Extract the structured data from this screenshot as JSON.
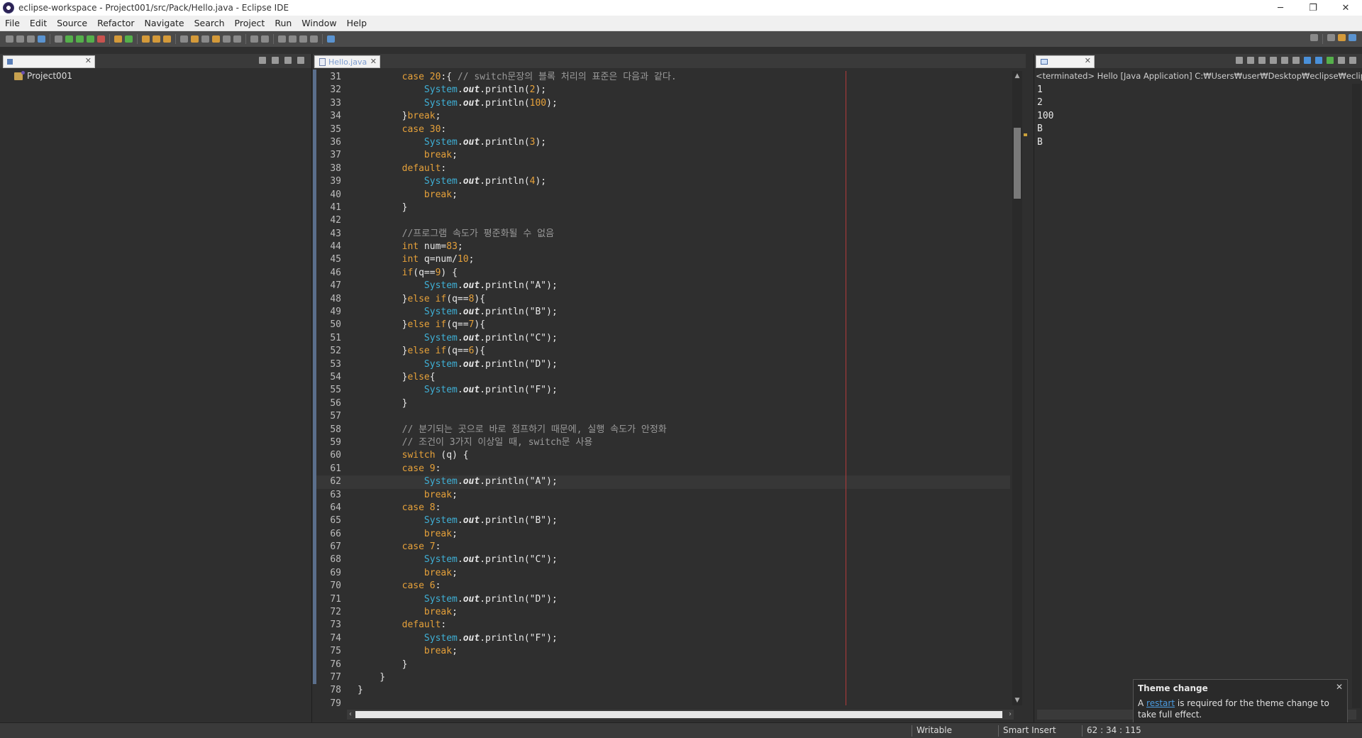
{
  "window": {
    "title": "eclipse-workspace - Project001/src/Pack/Hello.java - Eclipse IDE",
    "minimize": "─",
    "restore": "❐",
    "close": "✕"
  },
  "menubar": [
    "File",
    "Edit",
    "Source",
    "Refactor",
    "Navigate",
    "Search",
    "Project",
    "Run",
    "Window",
    "Help"
  ],
  "explorer": {
    "project": "Project001",
    "close_glyph": "✕"
  },
  "editor": {
    "tab_label": "Hello.java",
    "close_glyph": "✕",
    "current_line": 62
  },
  "code": [
    {
      "n": "31",
      "tokens": [
        [
          "pl",
          "        "
        ],
        [
          "kw",
          "case"
        ],
        [
          "pl",
          " "
        ],
        [
          "num",
          "20"
        ],
        [
          "pl",
          ":{ "
        ],
        [
          "cmt",
          "// switch문장의 블록 처리의 표준은 다음과 같다."
        ]
      ]
    },
    {
      "n": "32",
      "tokens": [
        [
          "pl",
          "            "
        ],
        [
          "cls",
          "System"
        ],
        [
          "pl",
          "."
        ],
        [
          "fld",
          "out"
        ],
        [
          "pl",
          ".println("
        ],
        [
          "num",
          "2"
        ],
        [
          "pl",
          ");"
        ]
      ]
    },
    {
      "n": "33",
      "tokens": [
        [
          "pl",
          "            "
        ],
        [
          "cls",
          "System"
        ],
        [
          "pl",
          "."
        ],
        [
          "fld",
          "out"
        ],
        [
          "pl",
          ".println("
        ],
        [
          "num",
          "100"
        ],
        [
          "pl",
          ");"
        ]
      ]
    },
    {
      "n": "34",
      "tokens": [
        [
          "pl",
          "        }"
        ],
        [
          "kw",
          "break"
        ],
        [
          "pl",
          ";"
        ]
      ]
    },
    {
      "n": "35",
      "tokens": [
        [
          "pl",
          "        "
        ],
        [
          "kw",
          "case"
        ],
        [
          "pl",
          " "
        ],
        [
          "num",
          "30"
        ],
        [
          "pl",
          ":"
        ]
      ]
    },
    {
      "n": "36",
      "tokens": [
        [
          "pl",
          "            "
        ],
        [
          "cls",
          "System"
        ],
        [
          "pl",
          "."
        ],
        [
          "fld",
          "out"
        ],
        [
          "pl",
          ".println("
        ],
        [
          "num",
          "3"
        ],
        [
          "pl",
          ");"
        ]
      ]
    },
    {
      "n": "37",
      "tokens": [
        [
          "pl",
          "            "
        ],
        [
          "kw",
          "break"
        ],
        [
          "pl",
          ";"
        ]
      ]
    },
    {
      "n": "38",
      "tokens": [
        [
          "pl",
          "        "
        ],
        [
          "kw",
          "default"
        ],
        [
          "pl",
          ":"
        ]
      ]
    },
    {
      "n": "39",
      "tokens": [
        [
          "pl",
          "            "
        ],
        [
          "cls",
          "System"
        ],
        [
          "pl",
          "."
        ],
        [
          "fld",
          "out"
        ],
        [
          "pl",
          ".println("
        ],
        [
          "num",
          "4"
        ],
        [
          "pl",
          ");"
        ]
      ]
    },
    {
      "n": "40",
      "tokens": [
        [
          "pl",
          "            "
        ],
        [
          "kw",
          "break"
        ],
        [
          "pl",
          ";"
        ]
      ]
    },
    {
      "n": "41",
      "tokens": [
        [
          "pl",
          "        }"
        ]
      ]
    },
    {
      "n": "42",
      "tokens": []
    },
    {
      "n": "43",
      "tokens": [
        [
          "pl",
          "        "
        ],
        [
          "cmt",
          "//프로그램 속도가 평준화될 수 없음"
        ]
      ]
    },
    {
      "n": "44",
      "tokens": [
        [
          "pl",
          "        "
        ],
        [
          "kw",
          "int"
        ],
        [
          "pl",
          " num="
        ],
        [
          "num",
          "83"
        ],
        [
          "pl",
          ";"
        ]
      ]
    },
    {
      "n": "45",
      "tokens": [
        [
          "pl",
          "        "
        ],
        [
          "kw",
          "int"
        ],
        [
          "pl",
          " q=num/"
        ],
        [
          "num",
          "10"
        ],
        [
          "pl",
          ";"
        ]
      ]
    },
    {
      "n": "46",
      "tokens": [
        [
          "pl",
          "        "
        ],
        [
          "kw",
          "if"
        ],
        [
          "pl",
          "(q=="
        ],
        [
          "num",
          "9"
        ],
        [
          "pl",
          ") {"
        ]
      ]
    },
    {
      "n": "47",
      "tokens": [
        [
          "pl",
          "            "
        ],
        [
          "cls",
          "System"
        ],
        [
          "pl",
          "."
        ],
        [
          "fld",
          "out"
        ],
        [
          "pl",
          ".println("
        ],
        [
          "str",
          "\"A\""
        ],
        [
          "pl",
          ");"
        ]
      ]
    },
    {
      "n": "48",
      "tokens": [
        [
          "pl",
          "        }"
        ],
        [
          "kw",
          "else"
        ],
        [
          "pl",
          " "
        ],
        [
          "kw",
          "if"
        ],
        [
          "pl",
          "(q=="
        ],
        [
          "num",
          "8"
        ],
        [
          "pl",
          "){"
        ]
      ]
    },
    {
      "n": "49",
      "tokens": [
        [
          "pl",
          "            "
        ],
        [
          "cls",
          "System"
        ],
        [
          "pl",
          "."
        ],
        [
          "fld",
          "out"
        ],
        [
          "pl",
          ".println("
        ],
        [
          "str",
          "\"B\""
        ],
        [
          "pl",
          ");"
        ]
      ]
    },
    {
      "n": "50",
      "tokens": [
        [
          "pl",
          "        }"
        ],
        [
          "kw",
          "else"
        ],
        [
          "pl",
          " "
        ],
        [
          "kw",
          "if"
        ],
        [
          "pl",
          "(q=="
        ],
        [
          "num",
          "7"
        ],
        [
          "pl",
          "){"
        ]
      ]
    },
    {
      "n": "51",
      "tokens": [
        [
          "pl",
          "            "
        ],
        [
          "cls",
          "System"
        ],
        [
          "pl",
          "."
        ],
        [
          "fld",
          "out"
        ],
        [
          "pl",
          ".println("
        ],
        [
          "str",
          "\"C\""
        ],
        [
          "pl",
          ");"
        ]
      ]
    },
    {
      "n": "52",
      "tokens": [
        [
          "pl",
          "        }"
        ],
        [
          "kw",
          "else"
        ],
        [
          "pl",
          " "
        ],
        [
          "kw",
          "if"
        ],
        [
          "pl",
          "(q=="
        ],
        [
          "num",
          "6"
        ],
        [
          "pl",
          "){"
        ]
      ]
    },
    {
      "n": "53",
      "tokens": [
        [
          "pl",
          "            "
        ],
        [
          "cls",
          "System"
        ],
        [
          "pl",
          "."
        ],
        [
          "fld",
          "out"
        ],
        [
          "pl",
          ".println("
        ],
        [
          "str",
          "\"D\""
        ],
        [
          "pl",
          ");"
        ]
      ]
    },
    {
      "n": "54",
      "tokens": [
        [
          "pl",
          "        }"
        ],
        [
          "kw",
          "else"
        ],
        [
          "pl",
          "{"
        ]
      ]
    },
    {
      "n": "55",
      "tokens": [
        [
          "pl",
          "            "
        ],
        [
          "cls",
          "System"
        ],
        [
          "pl",
          "."
        ],
        [
          "fld",
          "out"
        ],
        [
          "pl",
          ".println("
        ],
        [
          "str",
          "\"F\""
        ],
        [
          "pl",
          ");"
        ]
      ]
    },
    {
      "n": "56",
      "tokens": [
        [
          "pl",
          "        }"
        ]
      ]
    },
    {
      "n": "57",
      "tokens": []
    },
    {
      "n": "58",
      "tokens": [
        [
          "pl",
          "        "
        ],
        [
          "cmt",
          "// 분기되는 곳으로 바로 점프하기 때문에, 실행 속도가 안정화"
        ]
      ]
    },
    {
      "n": "59",
      "tokens": [
        [
          "pl",
          "        "
        ],
        [
          "cmt",
          "// 조건이 3가지 이상일 때, switch문 사용"
        ]
      ]
    },
    {
      "n": "60",
      "tokens": [
        [
          "pl",
          "        "
        ],
        [
          "kw",
          "switch"
        ],
        [
          "pl",
          " (q) {"
        ]
      ]
    },
    {
      "n": "61",
      "tokens": [
        [
          "pl",
          "        "
        ],
        [
          "kw",
          "case"
        ],
        [
          "pl",
          " "
        ],
        [
          "num",
          "9"
        ],
        [
          "pl",
          ":"
        ]
      ]
    },
    {
      "n": "62",
      "tokens": [
        [
          "pl",
          "            "
        ],
        [
          "cls",
          "System"
        ],
        [
          "pl",
          "."
        ],
        [
          "fld",
          "out"
        ],
        [
          "pl",
          ".println("
        ],
        [
          "str",
          "\"A\""
        ],
        [
          "pl",
          ");"
        ]
      ]
    },
    {
      "n": "63",
      "tokens": [
        [
          "pl",
          "            "
        ],
        [
          "kw",
          "break"
        ],
        [
          "pl",
          ";"
        ]
      ]
    },
    {
      "n": "64",
      "tokens": [
        [
          "pl",
          "        "
        ],
        [
          "kw",
          "case"
        ],
        [
          "pl",
          " "
        ],
        [
          "num",
          "8"
        ],
        [
          "pl",
          ":"
        ]
      ]
    },
    {
      "n": "65",
      "tokens": [
        [
          "pl",
          "            "
        ],
        [
          "cls",
          "System"
        ],
        [
          "pl",
          "."
        ],
        [
          "fld",
          "out"
        ],
        [
          "pl",
          ".println("
        ],
        [
          "str",
          "\"B\""
        ],
        [
          "pl",
          ");"
        ]
      ]
    },
    {
      "n": "66",
      "tokens": [
        [
          "pl",
          "            "
        ],
        [
          "kw",
          "break"
        ],
        [
          "pl",
          ";"
        ]
      ]
    },
    {
      "n": "67",
      "tokens": [
        [
          "pl",
          "        "
        ],
        [
          "kw",
          "case"
        ],
        [
          "pl",
          " "
        ],
        [
          "num",
          "7"
        ],
        [
          "pl",
          ":"
        ]
      ]
    },
    {
      "n": "68",
      "tokens": [
        [
          "pl",
          "            "
        ],
        [
          "cls",
          "System"
        ],
        [
          "pl",
          "."
        ],
        [
          "fld",
          "out"
        ],
        [
          "pl",
          ".println("
        ],
        [
          "str",
          "\"C\""
        ],
        [
          "pl",
          ");"
        ]
      ]
    },
    {
      "n": "69",
      "tokens": [
        [
          "pl",
          "            "
        ],
        [
          "kw",
          "break"
        ],
        [
          "pl",
          ";"
        ]
      ]
    },
    {
      "n": "70",
      "tokens": [
        [
          "pl",
          "        "
        ],
        [
          "kw",
          "case"
        ],
        [
          "pl",
          " "
        ],
        [
          "num",
          "6"
        ],
        [
          "pl",
          ":"
        ]
      ]
    },
    {
      "n": "71",
      "tokens": [
        [
          "pl",
          "            "
        ],
        [
          "cls",
          "System"
        ],
        [
          "pl",
          "."
        ],
        [
          "fld",
          "out"
        ],
        [
          "pl",
          ".println("
        ],
        [
          "str",
          "\"D\""
        ],
        [
          "pl",
          ");"
        ]
      ]
    },
    {
      "n": "72",
      "tokens": [
        [
          "pl",
          "            "
        ],
        [
          "kw",
          "break"
        ],
        [
          "pl",
          ";"
        ]
      ]
    },
    {
      "n": "73",
      "tokens": [
        [
          "pl",
          "        "
        ],
        [
          "kw",
          "default"
        ],
        [
          "pl",
          ":"
        ]
      ]
    },
    {
      "n": "74",
      "tokens": [
        [
          "pl",
          "            "
        ],
        [
          "cls",
          "System"
        ],
        [
          "pl",
          "."
        ],
        [
          "fld",
          "out"
        ],
        [
          "pl",
          ".println("
        ],
        [
          "str",
          "\"F\""
        ],
        [
          "pl",
          ");"
        ]
      ]
    },
    {
      "n": "75",
      "tokens": [
        [
          "pl",
          "            "
        ],
        [
          "kw",
          "break"
        ],
        [
          "pl",
          ";"
        ]
      ]
    },
    {
      "n": "76",
      "tokens": [
        [
          "pl",
          "        }"
        ]
      ]
    },
    {
      "n": "77",
      "tokens": [
        [
          "pl",
          "    }"
        ]
      ]
    },
    {
      "n": "78",
      "tokens": [
        [
          "pl",
          "}"
        ]
      ]
    },
    {
      "n": "79",
      "tokens": []
    }
  ],
  "console": {
    "close_glyph": "✕",
    "header": "<terminated> Hello [Java Application] C:₩Users₩user₩Desktop₩eclipse₩eclipse₩plu",
    "output": [
      "1",
      "2",
      "100",
      "B",
      "B"
    ]
  },
  "notification": {
    "title": "Theme change",
    "close_glyph": "✕",
    "body_prefix": "A ",
    "link": "restart",
    "body_suffix": " is required for the theme change to take full effect."
  },
  "statusbar": {
    "writable": "Writable",
    "insert_mode": "Smart Insert",
    "position": "62 : 34 : 115"
  },
  "colors": {
    "keyword": "#e6a13a",
    "class": "#3fb0d6",
    "comment": "#9a9a9a",
    "editor_bg": "#2f2f2f",
    "margin_line": "#b23a3a"
  }
}
